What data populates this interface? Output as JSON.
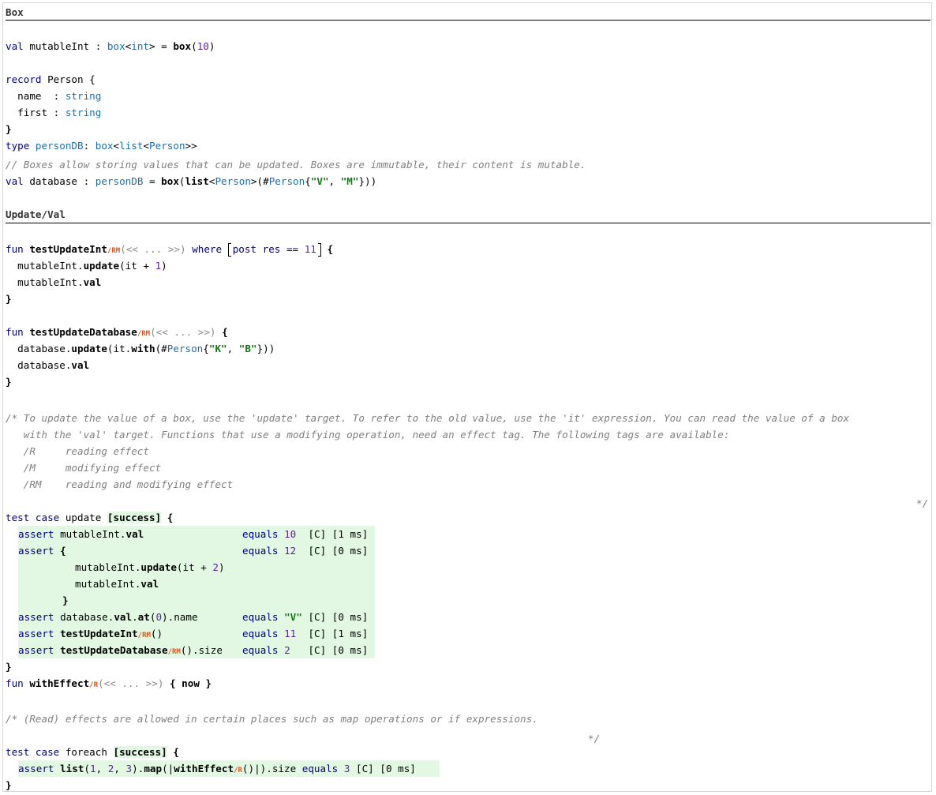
{
  "sections": {
    "box_title": "Box",
    "update_title": "Update/Val"
  },
  "box": {
    "l1": {
      "a": "val",
      "b": " mutableInt : ",
      "c": "box",
      "d": "<",
      "e": "int",
      "f": "> = ",
      "g": "box",
      "h": "(",
      "i": "10",
      "j": ")"
    },
    "l2": {
      "a": "record",
      "b": " Person {"
    },
    "l3": {
      "a": "  name  : ",
      "b": "string"
    },
    "l4": {
      "a": "  first : ",
      "b": "string"
    },
    "l5": "}",
    "l6": {
      "a": "type",
      "b": " personDB",
      "c": ": ",
      "d": "box",
      "e": "<",
      "f": "list",
      "g": "<",
      "h": "Person",
      "i": ">>"
    },
    "comment1": "// Boxes allow storing values that can be updated. Boxes are immutable, their content is mutable.",
    "l7": {
      "a": "val",
      "b": " database : ",
      "c": "personDB",
      "d": " = ",
      "e": "box",
      "f": "(",
      "g": "list",
      "h": "<",
      "i": "Person",
      "j": ">(#",
      "k": "Person",
      "l": "{",
      "m": "\"V\"",
      "n": ", ",
      "o": "\"M\"",
      "p": "}))"
    }
  },
  "update": {
    "f1": {
      "kw": "fun",
      "name": "testUpdateInt",
      "eff": "/RM",
      "args": "(<< ... >>)",
      "where": "where",
      "post": "post",
      "res": " res == ",
      "num": "11",
      "tail": " {"
    },
    "f1b1": {
      "a": "  mutableInt.",
      "b": "update",
      "c": "(it + ",
      "d": "1",
      "e": ")"
    },
    "f1b2": {
      "a": "  mutableInt.",
      "b": "val"
    },
    "f1end": "}",
    "f2": {
      "kw": "fun",
      "name": "testUpdateDatabase",
      "eff": "/RM",
      "args": "(<< ... >>)",
      "tail": " {"
    },
    "f2b1": {
      "a": "  database.",
      "b": "update",
      "c": "(it.",
      "d": "with",
      "e": "(#",
      "f": "Person",
      "g": "{",
      "h": "\"K\"",
      "i": ", ",
      "j": "\"B\"",
      "k": "}))"
    },
    "f2b2": {
      "a": "  database.",
      "b": "val"
    },
    "f2end": "}",
    "c1": "/* To update the value of a box, use the 'update' target. To refer to the old value, use the 'it' expression. You can read the value of a box",
    "c2": "   with the 'val' target. Functions that use a modifying operation, need an effect tag. The following tags are available:",
    "c3": "   /R     reading effect",
    "c4": "   /M     modifying effect",
    "c5": "   /RM    reading and modifying effect",
    "c6": "*/",
    "t1": {
      "a": "test case",
      "b": " update ",
      "c": "[success]",
      "d": " {"
    },
    "a1": {
      "kw": "assert",
      "expr": " mutableInt.",
      "b": "val",
      "eq": "equals",
      "num": "10",
      "status": "[C]",
      "time": "[1 ms]"
    },
    "a2": {
      "kw": "assert",
      "expr": " {",
      "eq": "equals",
      "num": "12",
      "status": "[C]",
      "time": "[0 ms]"
    },
    "a2b1": {
      "a": "mutableInt.",
      "b": "update",
      "c": "(it + ",
      "d": "2",
      "e": ")"
    },
    "a2b2": {
      "a": "mutableInt.",
      "b": "val"
    },
    "a2end": "}",
    "a3": {
      "kw": "assert",
      "expr": " database.",
      "b": "val",
      "c": ".",
      "d": "at",
      "e": "(",
      "f": "0",
      "g": ").name",
      "eq": "equals",
      "str": "\"V\"",
      "status": "[C]",
      "time": "[0 ms]"
    },
    "a4": {
      "kw": "assert",
      "name": " testUpdateInt",
      "eff": "/RM",
      "args": "()",
      "eq": "equals",
      "num": "11",
      "status": "[C]",
      "time": "[1 ms]"
    },
    "a5": {
      "kw": "assert",
      "name": " testUpdateDatabase",
      "eff": "/RM",
      "args": "().size",
      "eq": "equals",
      "num": "2",
      "status": "[C]",
      "time": "[0 ms]"
    },
    "t1end": "}",
    "f3": {
      "kw": "fun",
      "name": " withEffect",
      "eff": "/R",
      "args": "(<< ... >>)",
      "body": " { now }"
    },
    "c7": "/* (Read) effects are allowed in certain places such as map operations or if expressions.",
    "c8": "*/",
    "t2": {
      "a": "test case",
      "b": " foreach ",
      "c": "[success]",
      "d": " {"
    },
    "a6": {
      "kw": "assert",
      "a": " list",
      "b": "(",
      "n1": "1",
      "s1": ", ",
      "n2": "2",
      "s2": ", ",
      "n3": "3",
      "c": ").",
      "d": "map",
      "e": "(|",
      "f": "withEffect",
      "eff": "/R",
      "g": "()|).size ",
      "eq": "equals",
      "num": "3",
      "status": "[C]",
      "time": "[0 ms]"
    },
    "t2end": "}"
  }
}
